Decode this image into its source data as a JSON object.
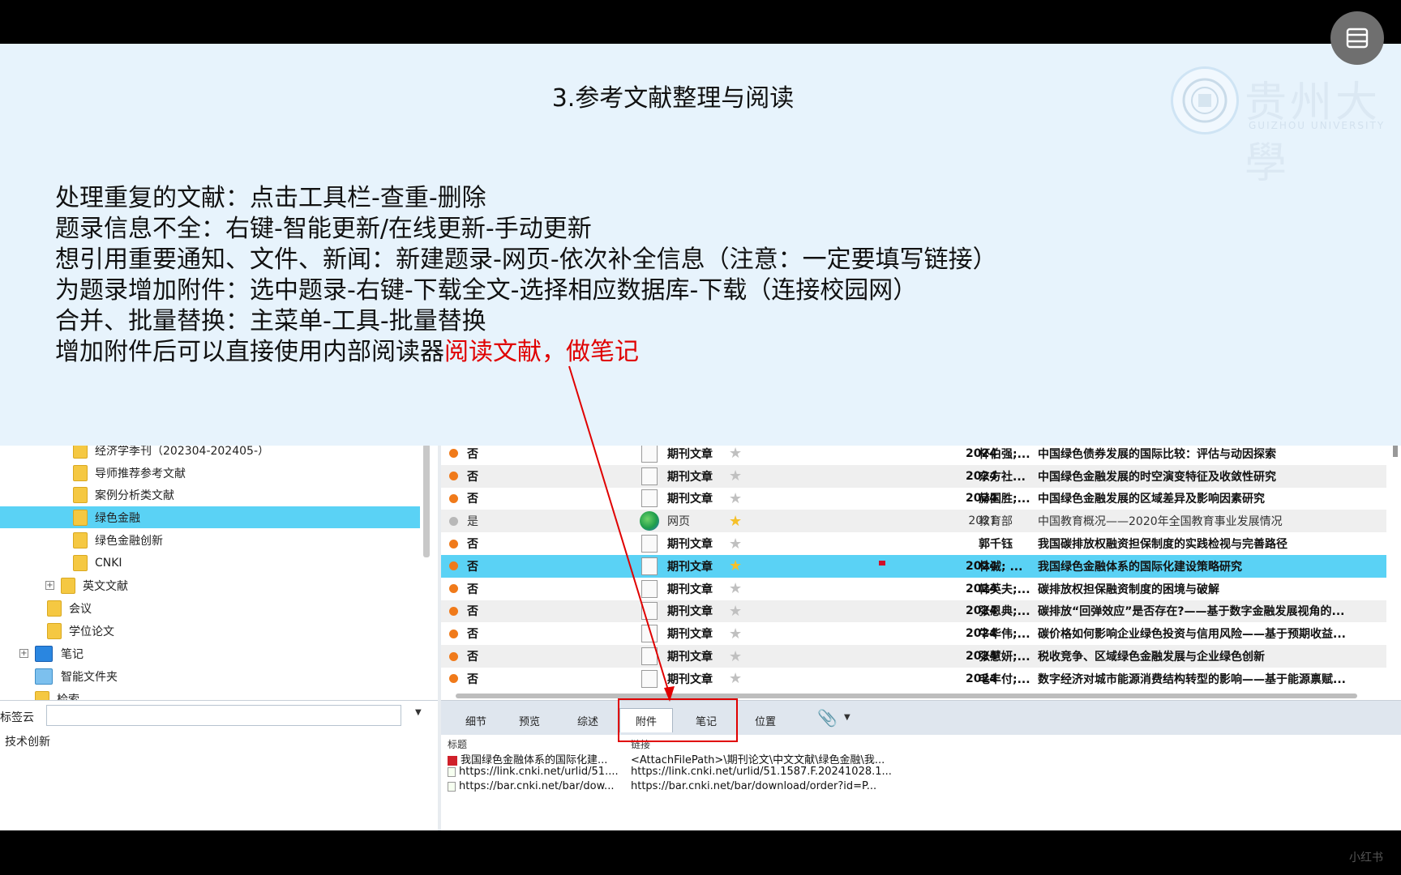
{
  "slide": {
    "title": "3.参考文献整理与阅读",
    "lines": [
      "处理重复的文献：点击工具栏-查重-删除",
      "题录信息不全：右键-智能更新/在线更新-手动更新",
      "想引用重要通知、文件、新闻：新建题录-网页-依次补全信息（注意：一定要填写链接）",
      "为题录增加附件：选中题录-右键-下载全文-选择相应数据库-下载（连接校园网）",
      "合并、批量替换：主菜单-工具-批量替换"
    ],
    "last_line_prefix": "增加附件后可以直接使用内部阅读器",
    "last_line_highlight": "阅读文献，做笔记",
    "logo_text": "贵州大學",
    "logo_sub": "GUIZHOU UNIVERSITY",
    "highlight_color": "#e00000"
  },
  "tree": {
    "items": [
      {
        "label": "经济学季刊（202304-202405-）",
        "type": "folder"
      },
      {
        "label": "导师推荐参考文献",
        "type": "folder"
      },
      {
        "label": "案例分析类文献",
        "type": "folder"
      },
      {
        "label": "绿色金融",
        "type": "folder",
        "selected": true
      },
      {
        "label": "绿色金融创新",
        "type": "folder"
      },
      {
        "label": "CNKI",
        "type": "folder"
      },
      {
        "label": "英文文献",
        "type": "folder"
      },
      {
        "label": "会议",
        "type": "folder"
      },
      {
        "label": "学位论文",
        "type": "folder"
      },
      {
        "label": "笔记",
        "type": "notebook"
      },
      {
        "label": "智能文件夹",
        "type": "smart"
      },
      {
        "label": "检索",
        "type": "folder"
      }
    ]
  },
  "tagcloud": {
    "label": "标签云",
    "input_value": "",
    "tags": [
      "技术创新"
    ]
  },
  "records": [
    {
      "read": "否",
      "type": "期刊文章",
      "star": false,
      "year": "2024",
      "author": "杯伯强;...",
      "title": "中国绿色债券发展的国际比较：评估与动因探索"
    },
    {
      "read": "否",
      "type": "期刊文章",
      "star": false,
      "year": "2024",
      "author": "东方社...",
      "title": "中国绿色金融发展的时空演变特征及收敛性研究"
    },
    {
      "read": "否",
      "type": "期刊文章",
      "star": false,
      "year": "2024",
      "author": "赫国胜;...",
      "title": "中国绿色金融发展的区域差异及影响因素研究"
    },
    {
      "read": "是",
      "type": "网页",
      "star": true,
      "year": "2021",
      "author": "教育部",
      "title": "中国教育概况——2020年全国教育事业发展情况"
    },
    {
      "read": "否",
      "type": "期刊文章",
      "star": false,
      "year": "",
      "author": "郭千钰",
      "title": "我国碳排放权融资担保制度的实践检视与完善路径"
    },
    {
      "read": "否",
      "type": "期刊文章",
      "star": true,
      "year": "2024",
      "author": "林诚; ...",
      "title": "我国绿色金融体系的国际化建设策略研究"
    },
    {
      "read": "否",
      "type": "期刊文章",
      "star": false,
      "year": "2024",
      "author": "韩英夫;...",
      "title": "碳排放权担保融资制度的困境与破解"
    },
    {
      "read": "否",
      "type": "期刊文章",
      "star": false,
      "year": "2024",
      "author": "张恩典;...",
      "title": "碳排放“回弹效应”是否存在?——基于数字金融发展视角的..."
    },
    {
      "read": "否",
      "type": "期刊文章",
      "star": false,
      "year": "2024",
      "author": "牛华伟;...",
      "title": "碳价格如何影响企业绿色投资与信用风险——基于预期收益..."
    },
    {
      "read": "否",
      "type": "期刊文章",
      "star": false,
      "year": "2024",
      "author": "张慧妍;...",
      "title": "税收竞争、区域绿色金融发展与企业绿色创新"
    },
    {
      "read": "否",
      "type": "期刊文章",
      "star": false,
      "year": "2024",
      "author": "毛丰付;...",
      "title": "数字经济对城市能源消费结构转型的影响——基于能源禀赋..."
    }
  ],
  "tabs": [
    {
      "label": "细节"
    },
    {
      "label": "预览"
    },
    {
      "label": "综述"
    },
    {
      "label": "附件",
      "active": true
    },
    {
      "label": "笔记"
    },
    {
      "label": "位置"
    }
  ],
  "attachments": {
    "col_title": "标题",
    "col_link": "链接",
    "rows": [
      {
        "icon": "pdf",
        "title": "我国绿色金融体系的国际化建...",
        "link": "<AttachFilePath>\\期刊论文\\中文文献\\绿色金融\\我..."
      },
      {
        "icon": "link",
        "title": "https://link.cnki.net/urlid/51....",
        "link": "https://link.cnki.net/urlid/51.1587.F.20241028.1..."
      },
      {
        "icon": "link",
        "title": "https://bar.cnki.net/bar/dow...",
        "link": "https://bar.cnki.net/bar/download/order?id=P..."
      }
    ]
  },
  "watermark": "小红书"
}
